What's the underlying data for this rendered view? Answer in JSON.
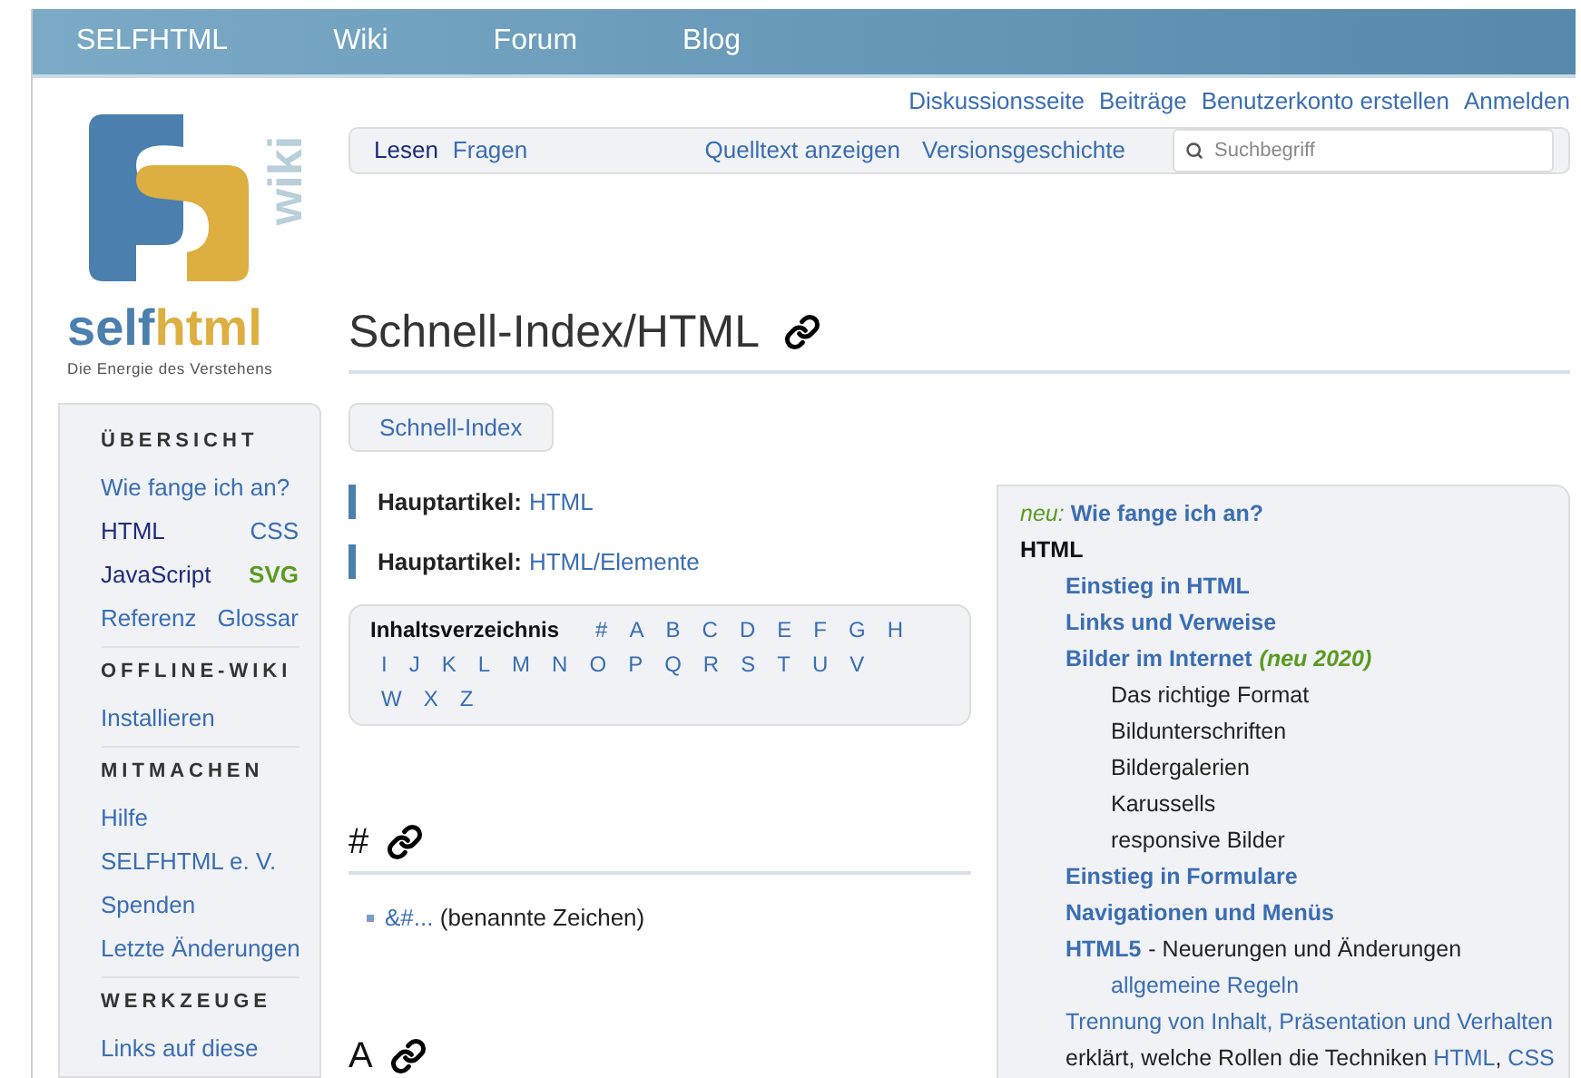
{
  "top_nav": [
    "SELFHTML",
    "Wiki",
    "Forum",
    "Blog"
  ],
  "personal_links": [
    "Diskussionsseite",
    "Beiträge",
    "Benutzerkonto erstellen",
    "Anmelden"
  ],
  "view_tabs": [
    {
      "label": "Lesen",
      "selected": true
    },
    {
      "label": "Fragen",
      "selected": false
    }
  ],
  "actions": [
    "Quelltext anzeigen",
    "Versionsgeschichte"
  ],
  "search": {
    "placeholder": "Suchbegriff"
  },
  "logo": {
    "word_1": "self",
    "word_2": "html",
    "side": "wiki",
    "tagline": "Die Energie des Verstehens"
  },
  "sidebar": {
    "sections": [
      {
        "title": "ÜBERSICHT",
        "rows": [
          [
            {
              "label": "Wie fange ich an?",
              "color": "#3a6db3"
            }
          ],
          [
            {
              "label": "HTML",
              "color": "#1f2a7a"
            },
            {
              "label": "CSS",
              "color": "#3a6db3"
            }
          ],
          [
            {
              "label": "JavaScript",
              "color": "#1f2a7a"
            },
            {
              "label": "SVG",
              "color": "#5b9a1e"
            }
          ],
          [
            {
              "label": "Referenz",
              "color": "#3a6db3"
            },
            {
              "label": "Glossar",
              "color": "#3a6db3"
            }
          ]
        ]
      },
      {
        "title": "OFFLINE-WIKI",
        "rows": [
          [
            {
              "label": "Installieren",
              "color": "#3a6db3"
            }
          ]
        ]
      },
      {
        "title": "MITMACHEN",
        "rows": [
          [
            {
              "label": "Hilfe",
              "color": "#3a6db3"
            }
          ],
          [
            {
              "label": "SELFHTML e. V.",
              "color": "#3a6db3"
            }
          ],
          [
            {
              "label": "Spenden",
              "color": "#3a6db3"
            }
          ],
          [
            {
              "label": "Letzte Änderungen",
              "color": "#3a6db3"
            }
          ]
        ]
      },
      {
        "title": "WERKZEUGE",
        "rows": [
          [
            {
              "label": "Links auf diese",
              "color": "#3a6db3"
            }
          ]
        ]
      }
    ]
  },
  "page_title": "Schnell-Index/HTML",
  "breadcrumb": "Schnell-Index",
  "main_articles": [
    {
      "label": "Hauptartikel:",
      "link": "HTML"
    },
    {
      "label": "Hauptartikel:",
      "link": "HTML/Elemente"
    }
  ],
  "toc": {
    "title": "Inhaltsverzeichnis",
    "letters": [
      "#",
      "A",
      "B",
      "C",
      "D",
      "E",
      "F",
      "G",
      "H",
      "I",
      "J",
      "K",
      "L",
      "M",
      "N",
      "O",
      "P",
      "Q",
      "R",
      "S",
      "T",
      "U",
      "V",
      "W",
      "X",
      "Z"
    ]
  },
  "sections": [
    {
      "heading": "#",
      "items": [
        {
          "link": "&#...",
          "text": "(benannte Zeichen)"
        }
      ]
    },
    {
      "heading": "A"
    }
  ],
  "infobox": {
    "intro": {
      "prefix": "neu:",
      "link": "Wie fange ich an?"
    },
    "title": "HTML",
    "children": [
      {
        "kind": "article",
        "label": "Einstieg in HTML"
      },
      {
        "kind": "article",
        "label": "Links und Verweise"
      },
      {
        "kind": "article",
        "label": "Bilder im Internet",
        "note": "(neu 2020)",
        "children": [
          {
            "kind": "plain",
            "label": "Das richtige Format"
          },
          {
            "kind": "plain",
            "label": "Bildunterschriften"
          },
          {
            "kind": "plain",
            "label": "Bildergalerien"
          },
          {
            "kind": "plain",
            "label": "Karussells"
          },
          {
            "kind": "plain",
            "label": "responsive Bilder"
          }
        ]
      },
      {
        "kind": "article",
        "label": "Einstieg in Formulare"
      },
      {
        "kind": "article",
        "label": "Navigationen und Menüs"
      },
      {
        "kind": "article",
        "label": "HTML5",
        "suffix": "- Neuerungen und Änderungen",
        "children": [
          {
            "kind": "link",
            "label": "allgemeine Regeln"
          }
        ]
      },
      {
        "kind": "link",
        "label": "Trennung von Inhalt, Präsentation und Verhalten"
      },
      {
        "kind": "sentence",
        "parts": [
          {
            "text": "erklärt, welche Rollen die Techniken",
            "link": false
          },
          {
            "text": "HTML",
            "link": true
          },
          {
            "text": ",",
            "link": false
          },
          {
            "text": "CSS",
            "link": true
          }
        ]
      }
    ]
  }
}
